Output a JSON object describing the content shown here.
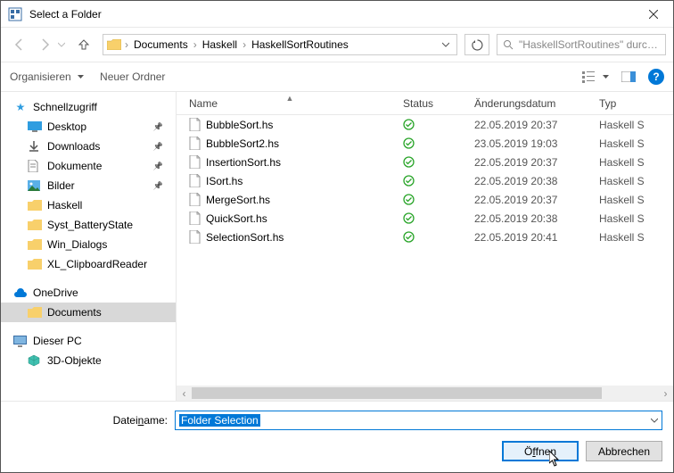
{
  "window": {
    "title": "Select a Folder"
  },
  "nav": {
    "crumbs": [
      "Documents",
      "Haskell",
      "HaskellSortRoutines"
    ],
    "search_placeholder": "\"HaskellSortRoutines\" durch..."
  },
  "toolbar": {
    "organize": "Organisieren",
    "newfolder": "Neuer Ordner"
  },
  "tree": {
    "quick": "Schnellzugriff",
    "desktop": "Desktop",
    "downloads": "Downloads",
    "documents": "Dokumente",
    "pictures": "Bilder",
    "haskell": "Haskell",
    "syst": "Syst_BatteryState",
    "windialogs": "Win_Dialogs",
    "xlclip": "XL_ClipboardReader",
    "onedrive": "OneDrive",
    "od_documents": "Documents",
    "thispc": "Dieser PC",
    "obj3d": "3D-Objekte"
  },
  "columns": {
    "name": "Name",
    "status": "Status",
    "date": "Änderungsdatum",
    "type": "Typ"
  },
  "files": [
    {
      "name": "BubbleSort.hs",
      "date": "22.05.2019 20:37",
      "type": "Haskell S"
    },
    {
      "name": "BubbleSort2.hs",
      "date": "23.05.2019 19:03",
      "type": "Haskell S"
    },
    {
      "name": "InsertionSort.hs",
      "date": "22.05.2019 20:37",
      "type": "Haskell S"
    },
    {
      "name": "ISort.hs",
      "date": "22.05.2019 20:38",
      "type": "Haskell S"
    },
    {
      "name": "MergeSort.hs",
      "date": "22.05.2019 20:37",
      "type": "Haskell S"
    },
    {
      "name": "QuickSort.hs",
      "date": "22.05.2019 20:38",
      "type": "Haskell S"
    },
    {
      "name": "SelectionSort.hs",
      "date": "22.05.2019 20:41",
      "type": "Haskell S"
    }
  ],
  "footer": {
    "filename_label_pre": "Datei",
    "filename_label_ul": "n",
    "filename_label_post": "ame:",
    "filename_value": "Folder Selection",
    "open_pre": "Ö",
    "open_ul": "f",
    "open_post": "fnen",
    "cancel": "Abbrechen"
  }
}
